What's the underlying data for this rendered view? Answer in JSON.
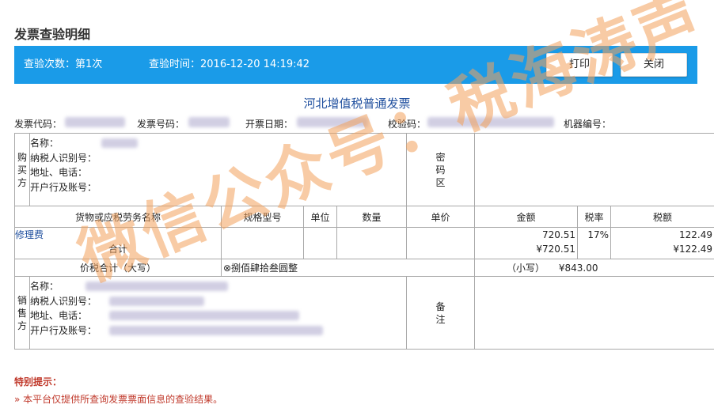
{
  "page": {
    "title": "发票查验明细"
  },
  "header_bar": {
    "check_count": "查验次数：第1次",
    "check_time": "查验时间：2016-12-20 14:19:42",
    "print_label": "打印",
    "close_label": "关闭"
  },
  "invoice": {
    "title": "河北增值税普通发票",
    "code_label": "发票代码：",
    "number_label": "发票号码：",
    "date_label": "开票日期：",
    "verify_label": "校验码：",
    "machine_label": "机器编号：",
    "buyer": {
      "side": "购买方",
      "name_label": "名称：",
      "tax_id_label": "纳税人识别号：",
      "address_label": "地址、电话：",
      "bank_label": "开户行及账号："
    },
    "cipher_label": "密码区",
    "columns": [
      "货物或应税劳务名称",
      "规格型号",
      "单位",
      "数量",
      "单价",
      "金额",
      "税率",
      "税额"
    ],
    "items": [
      {
        "name": "修理费",
        "amount": "720.51",
        "rate": "17%",
        "tax": "122.49"
      }
    ],
    "subtotal_label": "合计",
    "subtotal_amount": "¥720.51",
    "subtotal_tax": "¥122.49",
    "total_label": "价税合计（大写）",
    "total_upper": "⊗捌佰肆拾叁圆整",
    "total_lower_label": "（小写）",
    "total_lower": "¥843.00",
    "seller": {
      "side": "销售方",
      "name_label": "名称：",
      "tax_id_label": "纳税人识别号：",
      "address_label": "地址、电话：",
      "bank_label": "开户行及账号："
    },
    "remark_label": "备注"
  },
  "tips": {
    "heading": "特别提示：",
    "line1": "» 本平台仅提供所查询发票票面信息的查验结果。"
  },
  "watermark": {
    "text": "微信公众号：税海涛声"
  },
  "colors": {
    "bar": "#1a9be8",
    "title_blue": "#1f4f9e",
    "tip_red": "#c0392b",
    "watermark": "#f3a25d"
  }
}
